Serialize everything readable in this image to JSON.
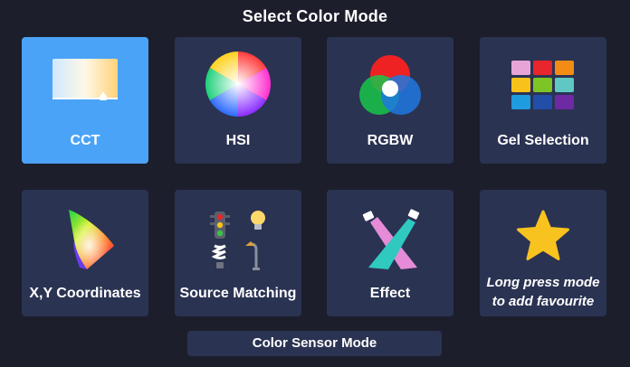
{
  "header": {
    "title": "Select Color Mode"
  },
  "modes": [
    {
      "label": "CCT",
      "icon": "cct-gradient-icon",
      "selected": true
    },
    {
      "label": "HSI",
      "icon": "hsi-color-wheel-icon",
      "selected": false
    },
    {
      "label": "RGBW",
      "icon": "rgbw-overlap-circles-icon",
      "selected": false
    },
    {
      "label": "Gel Selection",
      "icon": "gel-swatch-grid-icon",
      "selected": false
    },
    {
      "label": "X,Y Coordinates",
      "icon": "cie-chromaticity-icon",
      "selected": false
    },
    {
      "label": "Source Matching",
      "icon": "light-sources-icon",
      "selected": false
    },
    {
      "label": "Effect",
      "icon": "spotlights-icon",
      "selected": false
    },
    {
      "label": "Long press mode to add favourite",
      "icon": "star-icon",
      "selected": false
    }
  ],
  "footer": {
    "sensor_button": "Color Sensor Mode"
  },
  "colors": {
    "background": "#1c1e2c",
    "tile": "#2b3352",
    "selected_tile": "#4aa3f7",
    "star": "#f9c31f"
  }
}
